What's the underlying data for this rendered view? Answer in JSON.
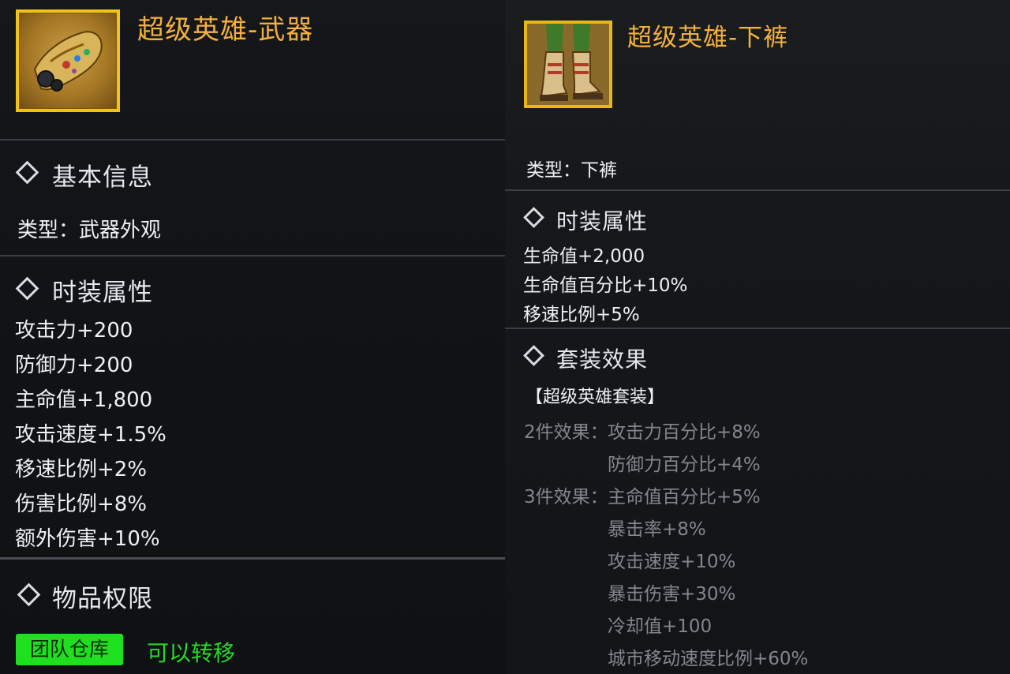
{
  "left_panel": {
    "item_title": "超级英雄-武器",
    "item_icon": "gauntlet-icon",
    "basic_info": {
      "title": "基本信息",
      "type_label": "类型：",
      "type_value": "武器外观"
    },
    "fashion_attrs": {
      "title": "时装属性",
      "lines": [
        "攻击力+200",
        "防御力+200",
        "主命值+1,800",
        "攻击速度+1.5%",
        "移速比例+2%",
        "伤害比例+8%",
        "额外伤害+10%"
      ]
    },
    "item_permissions": {
      "title": "物品权限",
      "badge": "团队仓库",
      "note": "可以转移"
    }
  },
  "right_panel": {
    "item_title": "超级英雄-下裤",
    "item_icon": "boots-icon",
    "type_label": "类型：",
    "type_value": "下裤",
    "fashion_attrs": {
      "title": "时装属性",
      "lines": [
        "生命值+2,000",
        "生命值百分比+10%",
        "移速比例+5%"
      ]
    },
    "set_effect": {
      "title": "套装效果",
      "set_name": "【超级英雄套装】",
      "two_piece_label": "2件效果：",
      "two_piece_effects": [
        "攻击力百分比+8%",
        "防御力百分比+4%"
      ],
      "three_piece_label": "3件效果：",
      "three_piece_effects": [
        "主命值百分比+5%",
        "暴击率+8%",
        "攻击速度+10%",
        "暴击伤害+30%",
        "冷却值+100",
        "城市移动速度比例+60%"
      ]
    }
  },
  "colors": {
    "title_gold": "#f3b03c",
    "icon_border": "#f2c314",
    "badge_green": "#1fe01f",
    "note_green": "#2bd62b",
    "muted_gray": "#83868b"
  }
}
